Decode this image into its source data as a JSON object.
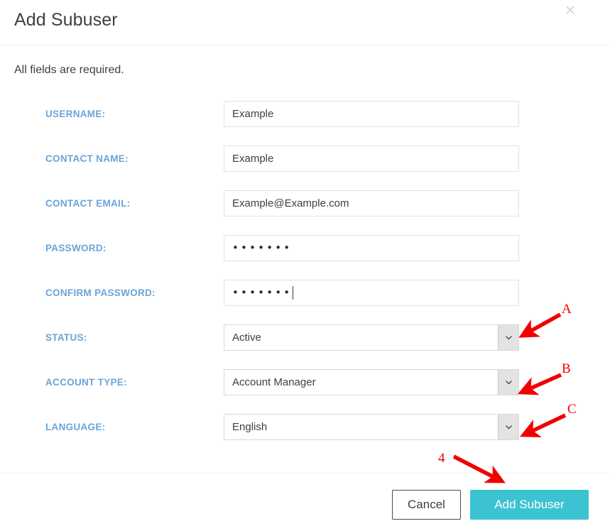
{
  "dialog": {
    "title": "Add Subuser",
    "close_icon": "close-icon",
    "required_note": "All fields are required."
  },
  "form": {
    "fields": [
      {
        "label": "USERNAME:",
        "type": "text",
        "value": "Example",
        "placeholder": ""
      },
      {
        "label": "CONTACT NAME:",
        "type": "text",
        "value": "Example",
        "placeholder": ""
      },
      {
        "label": "CONTACT EMAIL:",
        "type": "text",
        "value": "Example@Example.com",
        "placeholder": ""
      },
      {
        "label": "PASSWORD:",
        "type": "password",
        "masked": "•••••••",
        "caret": false
      },
      {
        "label": "CONFIRM PASSWORD:",
        "type": "password",
        "masked": "•••••••",
        "caret": true
      },
      {
        "label": "STATUS:",
        "type": "select",
        "value": "Active"
      },
      {
        "label": "ACCOUNT TYPE:",
        "type": "select",
        "value": "Account Manager"
      },
      {
        "label": "LANGUAGE:",
        "type": "select",
        "value": "English"
      }
    ]
  },
  "footer": {
    "cancel_label": "Cancel",
    "submit_label": "Add Subuser"
  },
  "annotations": {
    "items": [
      {
        "text": "A",
        "target": "status-select"
      },
      {
        "text": "B",
        "target": "account-type-select"
      },
      {
        "text": "C",
        "target": "language-select"
      },
      {
        "text": "4",
        "target": "add-subuser-button"
      }
    ],
    "color": "#f20000"
  },
  "colors": {
    "label_blue": "#6ba4d8",
    "primary_teal": "#3cc3d2",
    "annotation_red": "#f20000",
    "border_gray": "#e2e2e2",
    "divider_gray": "#eceeef"
  }
}
